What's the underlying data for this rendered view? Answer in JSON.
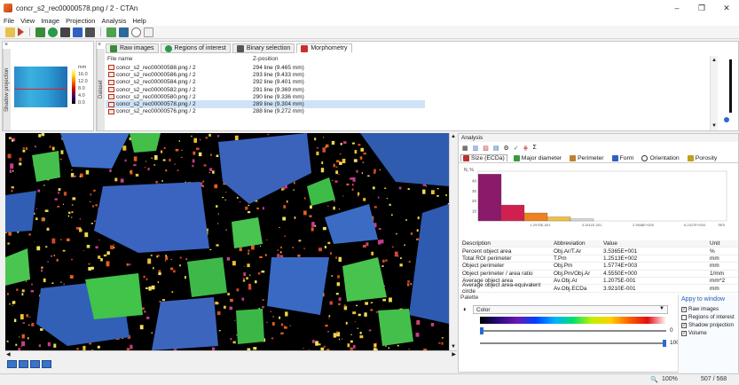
{
  "window": {
    "title": "concr_s2_rec00000578.png / 2 - CTAn",
    "controls": [
      "–",
      "❐",
      "✕"
    ]
  },
  "menu": [
    "File",
    "View",
    "Image",
    "Projection",
    "Analysis",
    "Help"
  ],
  "shadow_panel": {
    "label": "Shadow projection",
    "scale_unit": "mm",
    "scale_values": [
      "16.0",
      "12.0",
      "8.0",
      "4.0",
      "0.0"
    ]
  },
  "dataset_panel": {
    "label": "Dataset",
    "tabs": [
      {
        "label": "Raw images",
        "icon": "raw-images-icon",
        "color": "#3a8a3a"
      },
      {
        "label": "Regions of interest",
        "icon": "roi-icon",
        "color": "#2a9a4a"
      },
      {
        "label": "Binary selection",
        "icon": "binary-icon",
        "color": "#555555"
      },
      {
        "label": "Morphometry",
        "icon": "morphometry-icon",
        "color": "#c83030"
      }
    ],
    "columns": {
      "file": "File name",
      "z": "Z-position"
    },
    "rows": [
      {
        "file": "concr_s2_rec00000588.png / 2",
        "z": "294 line (9.465 mm)"
      },
      {
        "file": "concr_s2_rec00000586.png / 2",
        "z": "293 line (9.433 mm)"
      },
      {
        "file": "concr_s2_rec00000584.png / 2",
        "z": "292 line (9.401 mm)"
      },
      {
        "file": "concr_s2_rec00000582.png / 2",
        "z": "291 line (9.369 mm)"
      },
      {
        "file": "concr_s2_rec00000580.png / 2",
        "z": "290 line (9.336 mm)"
      },
      {
        "file": "concr_s2_rec00000578.png / 2",
        "z": "289 line (9.304 mm)"
      },
      {
        "file": "concr_s2_rec00000576.png / 2",
        "z": "288 line (9.272 mm)"
      }
    ],
    "selected_index": 5
  },
  "analysis": {
    "title": "Analysis",
    "tabs": [
      {
        "label": "Size (ECDa)",
        "color": "#c03030"
      },
      {
        "label": "Major diameter",
        "color": "#3a9a3a"
      },
      {
        "label": "Perimeter",
        "color": "#c08030"
      },
      {
        "label": "Form",
        "color": "#3060c0"
      },
      {
        "label": "Orientation",
        "color": "#333333"
      },
      {
        "label": "Porosity",
        "color": "#c0a020"
      }
    ],
    "table_headers": [
      "Description",
      "Abbreviation",
      "Value",
      "Unit"
    ],
    "table_rows": [
      [
        "Percent object area",
        "Obj.Ar/T.Ar",
        "3.5365E+001",
        "%"
      ],
      [
        "Total ROI perimeter",
        "T.Pm",
        "1.2513E+002",
        "mm"
      ],
      [
        "Object perimeter",
        "Obj.Pm",
        "1.5774E+003",
        "mm"
      ],
      [
        "Object perimeter / area ratio",
        "Obj.Pm/Obj.Ar",
        "4.5550E+000",
        "1/mm"
      ],
      [
        "Average object area",
        "Av.Obj.Ar",
        "1.2075E-001",
        "mm^2"
      ],
      [
        "Average object area-equivalent circle",
        "Av.Obj.ECDa",
        "3.9210E-001",
        "mm"
      ]
    ]
  },
  "chart_data": {
    "type": "bar",
    "ylabel": "N, %",
    "xlabel": "mm",
    "ylim": [
      0,
      50
    ],
    "y_ticks": [
      "40",
      "30",
      "20",
      "10"
    ],
    "x_ticks": [
      "1.2975E-001",
      "3.1511E-001",
      "2.9548E+000",
      "6.2417E+000"
    ],
    "values": [
      47,
      16,
      8,
      4,
      2
    ],
    "colors": [
      "#8a1a6a",
      "#d02050",
      "#f08020",
      "#f0c040",
      "#d8d8d8"
    ]
  },
  "palette": {
    "title": "Palette",
    "selected": "Color",
    "min": "0",
    "max": "100",
    "apply_title": "Appy to window",
    "apply_options": [
      {
        "label": "Raw images",
        "checked": true
      },
      {
        "label": "Regions of interest",
        "checked": false
      },
      {
        "label": "Shadow projection",
        "checked": true
      },
      {
        "label": "Volume",
        "checked": true
      }
    ]
  },
  "status": {
    "zoom": "100%",
    "position": "507 / 568"
  }
}
